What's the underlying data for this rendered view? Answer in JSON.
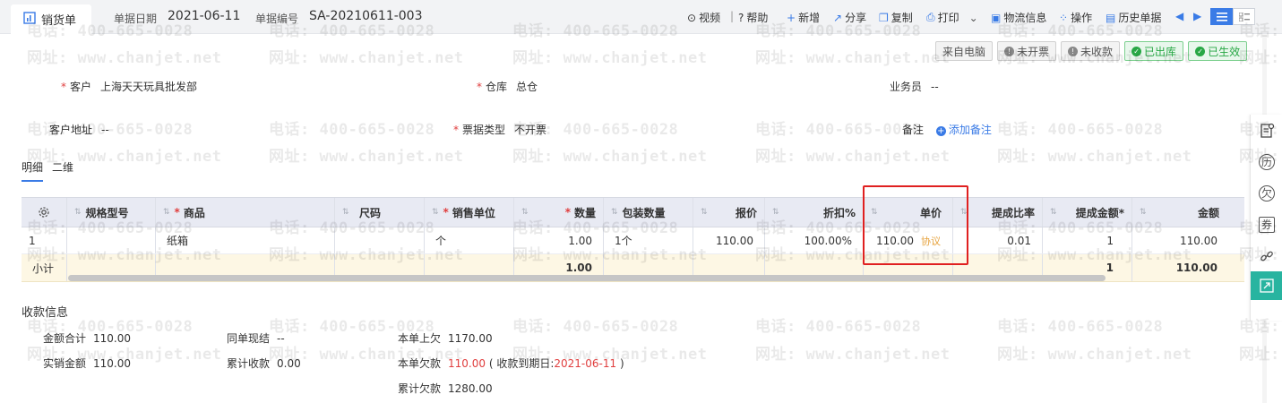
{
  "watermark": {
    "phone": "电话: 400-665-0028",
    "site": "网址: www.chanjet.net"
  },
  "header": {
    "doc_title": "销货单",
    "date_label": "单据日期",
    "date_value": "2021-06-11",
    "no_label": "单据编号",
    "no_value": "SA-20210611-003"
  },
  "toolbar": {
    "video": "视频",
    "sep": "|",
    "help": "帮助",
    "new": "新增",
    "share": "分享",
    "copy": "复制",
    "print": "打印",
    "logistics": "物流信息",
    "operate": "操作",
    "history": "历史单据"
  },
  "badges": {
    "from_pc": "来自电脑",
    "not_invoiced": "未开票",
    "not_collected": "未收款",
    "out_stock": "已出库",
    "effective": "已生效"
  },
  "form": {
    "customer_label": "客户",
    "customer_value": "上海天天玩具批发部",
    "warehouse_label": "仓库",
    "warehouse_value": "总仓",
    "salesman_label": "业务员",
    "salesman_value": "--",
    "address_label": "客户地址",
    "address_value": "--",
    "invoice_type_label": "票据类型",
    "invoice_type_value": "不开票",
    "note_label": "备注",
    "add_note": "添加备注"
  },
  "tabs": {
    "detail": "明细",
    "second": "二维"
  },
  "table": {
    "headers": {
      "spec": "规格型号",
      "product": "商品",
      "size": "尺码",
      "unit": "销售单位",
      "qty": "数量",
      "pack_qty": "包装数量",
      "quote": "报价",
      "discount": "折扣%",
      "price": "单价",
      "commission_rate": "提成比率",
      "commission_amount": "提成金额*",
      "amount": "金额"
    },
    "row": {
      "index": "1",
      "product": "纸箱",
      "unit": "个",
      "qty": "1.00",
      "pack_qty": "1个",
      "quote": "110.00",
      "discount": "100.00%",
      "price": "110.00",
      "price_tag": "协议",
      "commission_rate": "0.01",
      "commission_amount": "1",
      "amount": "110.00"
    },
    "subtotal": {
      "label": "小计",
      "qty": "1.00",
      "commission_amount": "1",
      "amount": "110.00"
    }
  },
  "payment": {
    "title": "收款信息",
    "total_label": "金额合计",
    "total_value": "110.00",
    "actual_label": "实销金额",
    "actual_value": "110.00",
    "cash_label": "同单现结",
    "cash_value": "--",
    "cum_collect_label": "累计收款",
    "cum_collect_value": "0.00",
    "prev_owe_label": "本单上欠",
    "prev_owe_value": "1170.00",
    "owe_label": "本单欠款",
    "owe_value": "110.00",
    "due_prefix": "( 收款到期日:",
    "due_date": "2021-06-11",
    "due_suffix": ")",
    "cum_owe_label": "累计欠款",
    "cum_owe_value": "1280.00"
  },
  "rail": {
    "icons": [
      "document-check-icon",
      "history-icon",
      "owe-icon",
      "voucher-icon",
      "link-icon",
      "expand-icon"
    ],
    "history_glyph": "历",
    "owe_glyph": "欠",
    "voucher_glyph": "券"
  },
  "colors": {
    "accent": "#3a7be6",
    "required": "#e03e3e",
    "green": "#28a745",
    "teal": "#28b4a0",
    "highlight": "#e02020"
  }
}
